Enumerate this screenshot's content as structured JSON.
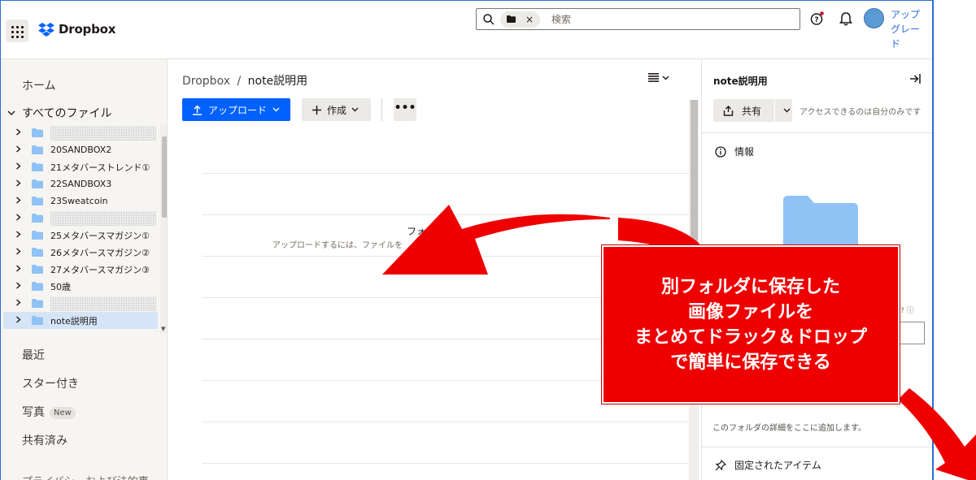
{
  "topbar": {
    "logo_text": "Dropbox",
    "search_placeholder": "検索",
    "chip_close": "×",
    "upgrade_line1": "アップ",
    "upgrade_line2": "グレー",
    "upgrade_line3": "ド"
  },
  "sidebar": {
    "home": "ホーム",
    "all_files": "すべてのファイル",
    "tree": [
      {
        "label": "",
        "redacted": true
      },
      {
        "label": "20SANDBOX2"
      },
      {
        "label": "21メタバーストレンド①"
      },
      {
        "label": "22SANDBOX3"
      },
      {
        "label": "23Sweatcoin"
      },
      {
        "label": "",
        "redacted": true
      },
      {
        "label": "25メタバースマガジン①"
      },
      {
        "label": "26メタバースマガジン②"
      },
      {
        "label": "27メタバースマガジン③"
      },
      {
        "label": "50歳"
      },
      {
        "label": "",
        "redacted": true
      },
      {
        "label": "note説明用",
        "selected": true
      }
    ],
    "recent": "最近",
    "starred": "スター付き",
    "photos": "写真",
    "photos_badge": "New",
    "shared": "共有済み",
    "privacy": "プライバシーおよび法的事"
  },
  "main": {
    "breadcrumb_root": "Dropbox",
    "breadcrumb_sep": "/",
    "breadcrumb_current": "note説明用",
    "upload_label": "アップロード",
    "create_label": "作成",
    "more_label": "•••",
    "empty_title": "フォ",
    "empty_sub": "アップロードするには、ファイルを"
  },
  "panel": {
    "title": "note説明用",
    "share_label": "共有",
    "access_text": "アクセスできるのは自分のみです",
    "info_label": "情報",
    "help_mini": "? ⓘ",
    "details_hint": "このフォルダの詳細をここに追加します。",
    "pinned_label": "固定されたアイテム"
  },
  "callout": {
    "line1": "別フォルダに保存した",
    "line2": "画像ファイルを",
    "line3": "まとめてドラック＆ドロップ",
    "line4": "で簡単に保存できる"
  },
  "colors": {
    "accent": "#0061fe",
    "folder": "#90c2f5",
    "callout": "#ef0000"
  }
}
